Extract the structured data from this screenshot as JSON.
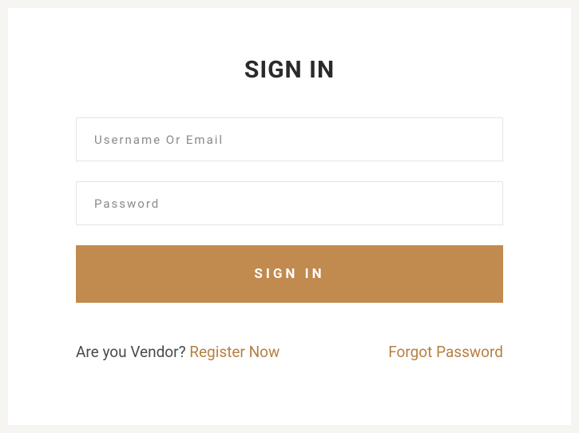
{
  "title": "SIGN IN",
  "form": {
    "username_placeholder": "Username Or Email",
    "password_placeholder": "Password",
    "submit_label": "SIGN IN"
  },
  "footer": {
    "vendor_prompt": "Are you Vendor? ",
    "register_label": "Register Now",
    "forgot_label": "Forgot Password"
  }
}
